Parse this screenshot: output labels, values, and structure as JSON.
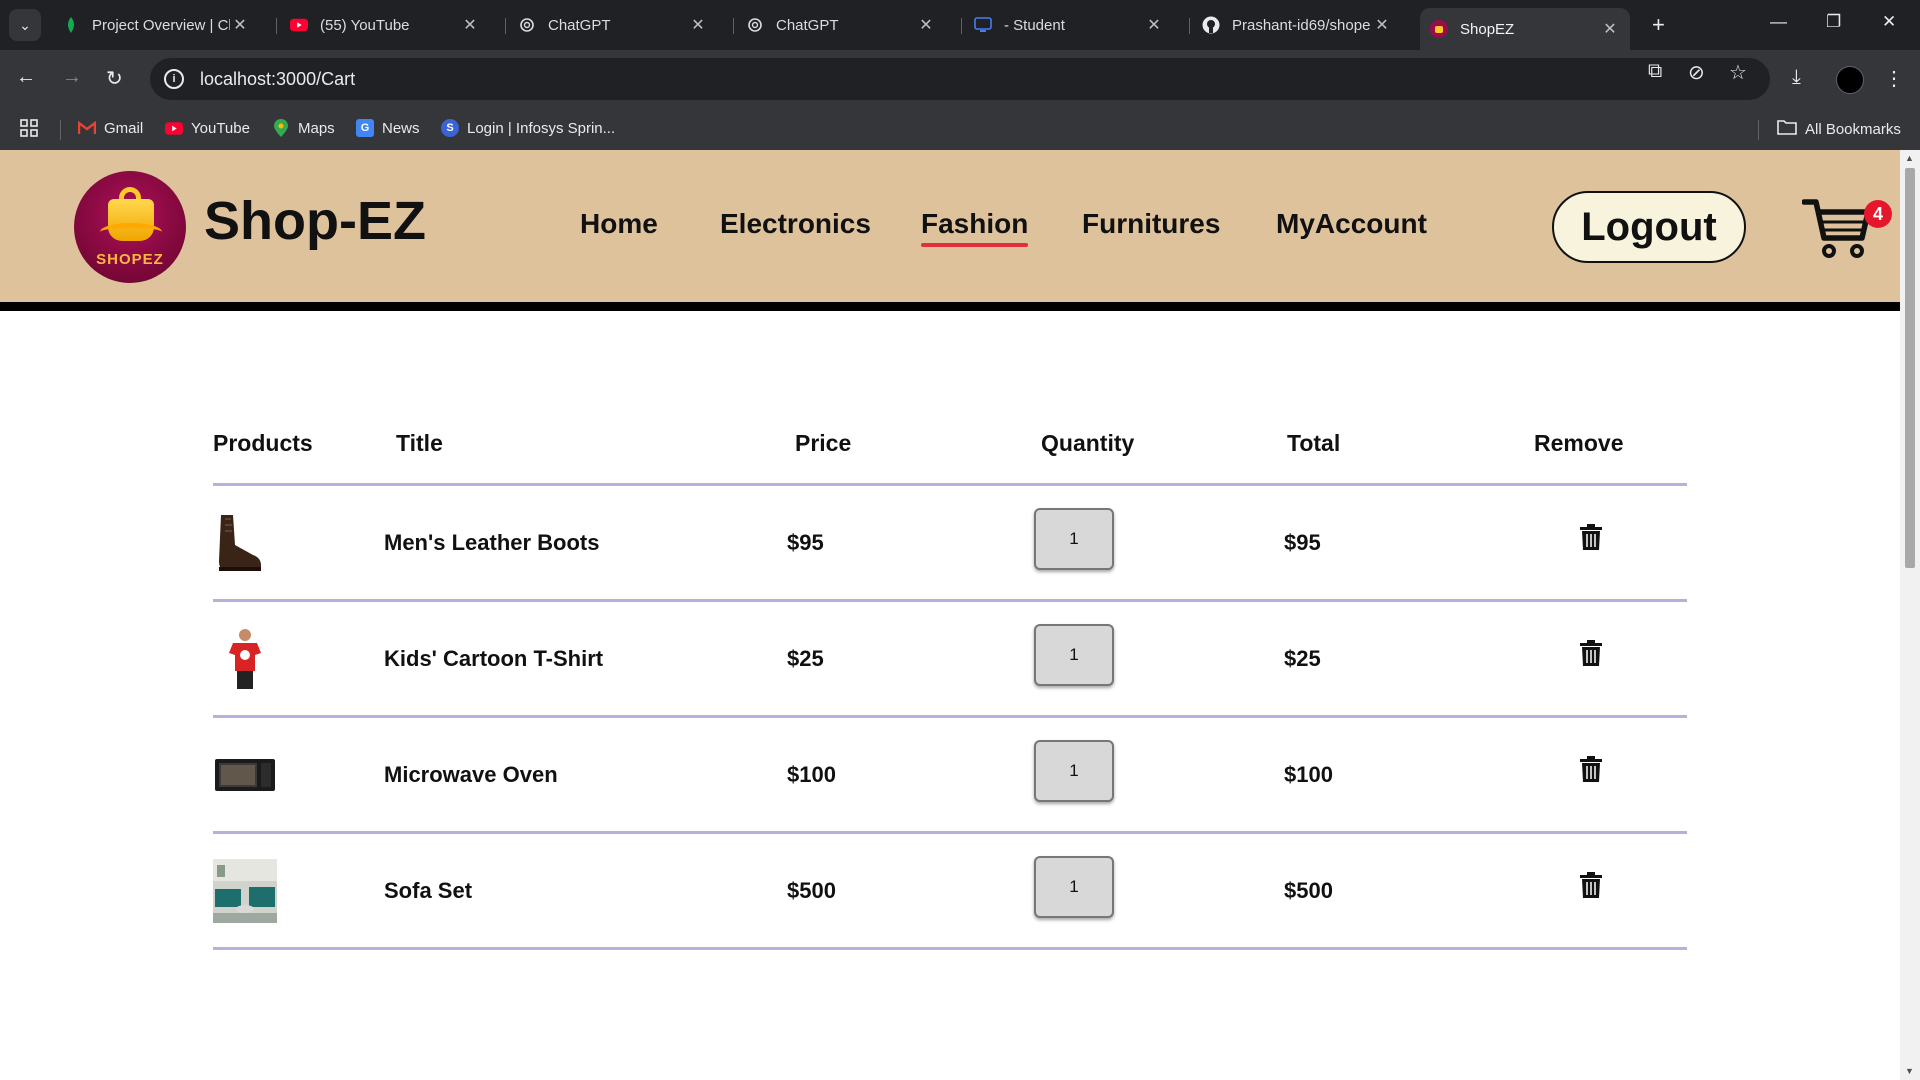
{
  "browser": {
    "tabs": [
      {
        "title": "Project Overview | Cl",
        "icon": "leaf-icon"
      },
      {
        "title": "(55) YouTube",
        "icon": "youtube-icon"
      },
      {
        "title": "ChatGPT",
        "icon": "chatgpt-icon"
      },
      {
        "title": "ChatGPT",
        "icon": "chatgpt-icon"
      },
      {
        "title": "- Student",
        "icon": "monitor-icon"
      },
      {
        "title": "Prashant-id69/shope",
        "icon": "github-icon"
      },
      {
        "title": "ShopEZ",
        "icon": "shopez-icon"
      }
    ],
    "active_tab_index": 6,
    "url": "localhost:3000/Cart",
    "bookmarks": [
      {
        "label": "Gmail",
        "icon": "gmail-icon"
      },
      {
        "label": "YouTube",
        "icon": "youtube-icon"
      },
      {
        "label": "Maps",
        "icon": "maps-icon"
      },
      {
        "label": "News",
        "icon": "news-icon"
      },
      {
        "label": "Login | Infosys Sprin...",
        "icon": "infosys-icon"
      }
    ],
    "all_bookmarks": "All Bookmarks"
  },
  "site": {
    "logo_text": "SHOPEZ",
    "brand": "Shop-EZ",
    "nav": [
      "Home",
      "Electronics",
      "Fashion",
      "Furnitures",
      "MyAccount"
    ],
    "active_nav": "Fashion",
    "logout": "Logout",
    "cart_count": "4",
    "accent_underline": "#e0303a",
    "header_bg": "#dec29b"
  },
  "cart": {
    "headers": {
      "products": "Products",
      "title": "Title",
      "price": "Price",
      "quantity": "Quantity",
      "total": "Total",
      "remove": "Remove"
    },
    "items": [
      {
        "title": "Men's Leather Boots",
        "price": "$95",
        "quantity": "1",
        "total": "$95",
        "thumb": "boots"
      },
      {
        "title": "Kids' Cartoon T-Shirt",
        "price": "$25",
        "quantity": "1",
        "total": "$25",
        "thumb": "tshirt"
      },
      {
        "title": "Microwave Oven",
        "price": "$100",
        "quantity": "1",
        "total": "$100",
        "thumb": "microwave"
      },
      {
        "title": "Sofa Set",
        "price": "$500",
        "quantity": "1",
        "total": "$500",
        "thumb": "sofa"
      }
    ]
  }
}
